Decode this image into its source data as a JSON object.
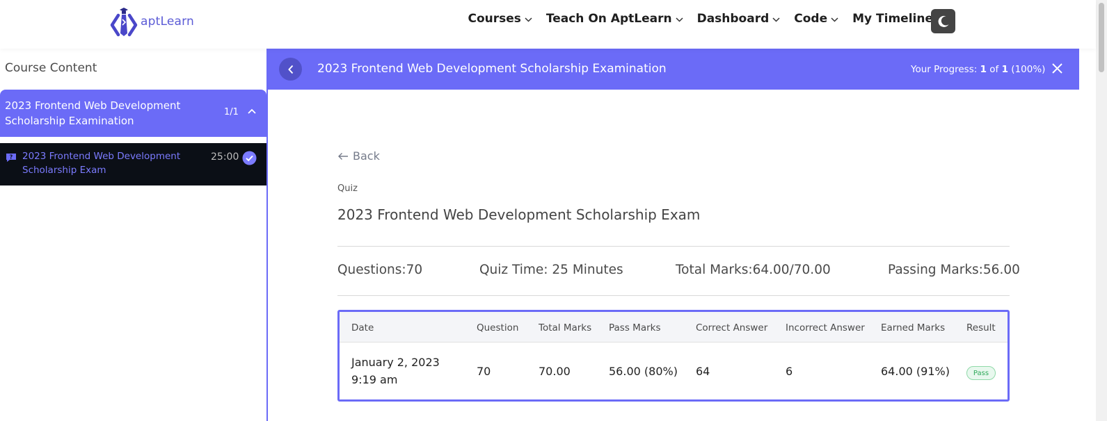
{
  "brand": {
    "name": "aptLearn"
  },
  "nav": {
    "items": [
      {
        "label": "Courses"
      },
      {
        "label": "Teach On AptLearn"
      },
      {
        "label": "Dashboard"
      },
      {
        "label": "Code"
      },
      {
        "label": "My Timeline"
      }
    ]
  },
  "sidebar": {
    "heading": "Course Content",
    "topic": {
      "title": "2023 Frontend Web Development Scholarship Examination",
      "count": "1/1"
    },
    "lesson": {
      "title": "2023 Frontend Web Development Scholarship Exam",
      "duration": "25:00"
    }
  },
  "course_bar": {
    "title": "2023 Frontend Web Development Scholarship Examination",
    "progress_label": "Your Progress:",
    "progress_current": "1",
    "progress_of": "of",
    "progress_total": "1",
    "progress_percent": "(100%)",
    "progress_value": 1.0
  },
  "main": {
    "back_label": "Back",
    "quiz_label": "Quiz",
    "quiz_title": "2023 Frontend Web Development Scholarship Exam",
    "meta": {
      "questions": "Questions:70",
      "quiz_time": "Quiz Time: 25 Minutes",
      "total_marks": "Total Marks:64.00/70.00",
      "passing_marks": "Passing Marks:56.00"
    },
    "table": {
      "headers": [
        "Date",
        "Question",
        "Total Marks",
        "Pass Marks",
        "Correct Answer",
        "Incorrect Answer",
        "Earned Marks",
        "Result"
      ],
      "row": {
        "date": "January 2, 2023",
        "time": "9:19 am",
        "question": "70",
        "total_marks": "70.00",
        "pass_marks": "56.00 (80%)",
        "correct": "64",
        "incorrect": "6",
        "earned": "64.00 (91%)",
        "result": "Pass"
      }
    }
  },
  "colors": {
    "accent": "#6b6bf7",
    "dark": "#0b0f16",
    "pass_green": "#2faa5a"
  },
  "icons": {
    "logo": "aptlearn-logo-icon",
    "theme": "moon-icon",
    "back": "chevron-left-icon",
    "close": "close-icon",
    "quiz": "quiz-icon",
    "complete": "check-circle-icon",
    "back_arrow": "arrow-left-icon"
  }
}
